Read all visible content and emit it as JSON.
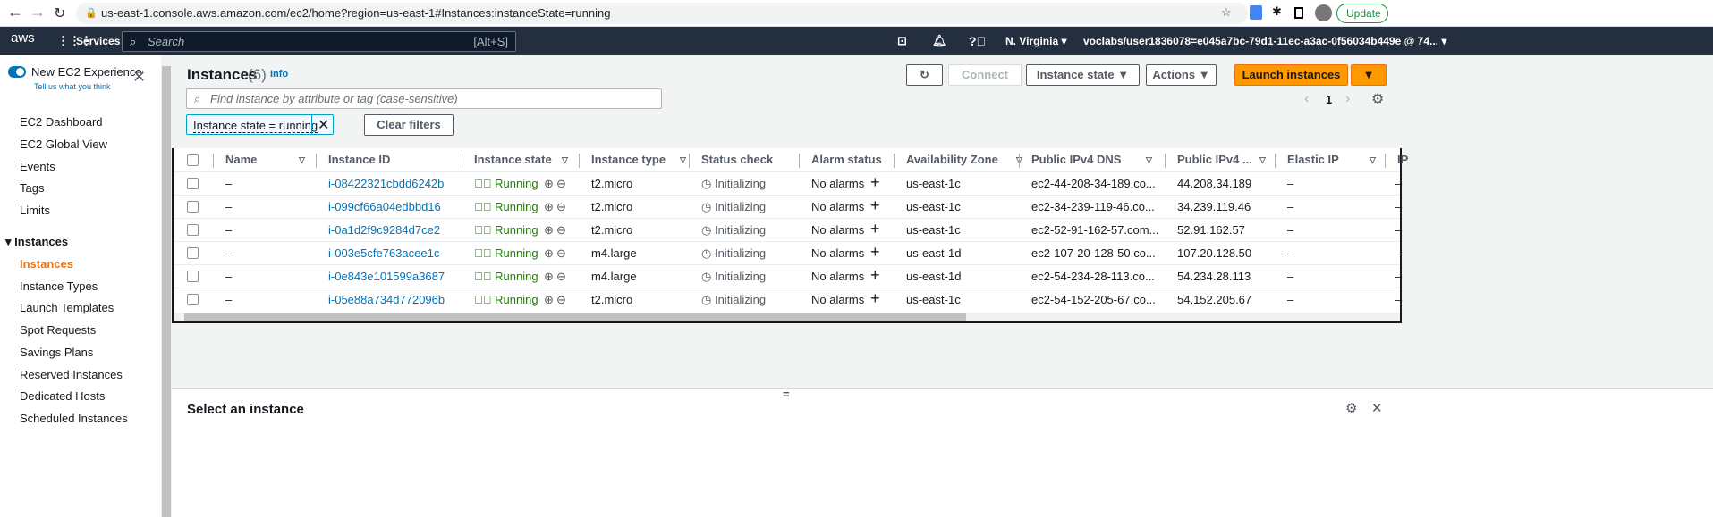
{
  "browser": {
    "url": "us-east-1.console.aws.amazon.com/ec2/home?region=us-east-1#Instances:instanceState=running",
    "update": "Update"
  },
  "aws": {
    "logo": "aws",
    "services": "Services",
    "search_placeholder": "Search",
    "search_shortcut": "[Alt+S]",
    "region": "N. Virginia",
    "account": "voclabs/user1836078=e045a7bc-79d1-11ec-a3ac-0f56034b449e @ 74..."
  },
  "sidebar": {
    "toggle_label": "New EC2 Experience",
    "feedback": "Tell us what you think",
    "items": [
      "EC2 Dashboard",
      "EC2 Global View",
      "Events",
      "Tags",
      "Limits"
    ],
    "section": "Instances",
    "sub_items": [
      "Instances",
      "Instance Types",
      "Launch Templates",
      "Spot Requests",
      "Savings Plans",
      "Reserved Instances",
      "Dedicated Hosts",
      "Scheduled Instances"
    ]
  },
  "main": {
    "title": "Instances",
    "count": "(6)",
    "info": "Info",
    "connect": "Connect",
    "instance_state": "Instance state",
    "actions": "Actions",
    "launch": "Launch instances",
    "find_placeholder": "Find instance by attribute or tag (case-sensitive)",
    "filter_token": "Instance state = running",
    "clear_filters": "Clear filters",
    "page": "1"
  },
  "table": {
    "columns": [
      "Name",
      "Instance ID",
      "Instance state",
      "Instance type",
      "Status check",
      "Alarm status",
      "Availability Zone",
      "Public IPv4 DNS",
      "Public IPv4 ...",
      "Elastic IP",
      "IP"
    ],
    "rows": [
      {
        "name": "–",
        "id": "i-08422321cbdd6242b",
        "state": "Running",
        "type": "t2.micro",
        "status": "Initializing",
        "alarm": "No alarms",
        "az": "us-east-1c",
        "dns": "ec2-44-208-34-189.co...",
        "ip": "44.208.34.189",
        "eip": "–",
        "ipv6": "–"
      },
      {
        "name": "–",
        "id": "i-099cf66a04edbbd16",
        "state": "Running",
        "type": "t2.micro",
        "status": "Initializing",
        "alarm": "No alarms",
        "az": "us-east-1c",
        "dns": "ec2-34-239-119-46.co...",
        "ip": "34.239.119.46",
        "eip": "–",
        "ipv6": "–"
      },
      {
        "name": "–",
        "id": "i-0a1d2f9c9284d7ce2",
        "state": "Running",
        "type": "t2.micro",
        "status": "Initializing",
        "alarm": "No alarms",
        "az": "us-east-1c",
        "dns": "ec2-52-91-162-57.com...",
        "ip": "52.91.162.57",
        "eip": "–",
        "ipv6": "–"
      },
      {
        "name": "–",
        "id": "i-003e5cfe763acee1c",
        "state": "Running",
        "type": "m4.large",
        "status": "Initializing",
        "alarm": "No alarms",
        "az": "us-east-1d",
        "dns": "ec2-107-20-128-50.co...",
        "ip": "107.20.128.50",
        "eip": "–",
        "ipv6": "–"
      },
      {
        "name": "–",
        "id": "i-0e843e101599a3687",
        "state": "Running",
        "type": "m4.large",
        "status": "Initializing",
        "alarm": "No alarms",
        "az": "us-east-1d",
        "dns": "ec2-54-234-28-113.co...",
        "ip": "54.234.28.113",
        "eip": "–",
        "ipv6": "–"
      },
      {
        "name": "–",
        "id": "i-05e88a734d772096b",
        "state": "Running",
        "type": "t2.micro",
        "status": "Initializing",
        "alarm": "No alarms",
        "az": "us-east-1c",
        "dns": "ec2-54-152-205-67.co...",
        "ip": "54.152.205.67",
        "eip": "–",
        "ipv6": "–"
      }
    ]
  },
  "details": {
    "title": "Select an instance"
  },
  "colors": {
    "accent": "#ff9900",
    "link": "#0073bb",
    "running": "#1d8102",
    "nav": "#232f3e"
  }
}
